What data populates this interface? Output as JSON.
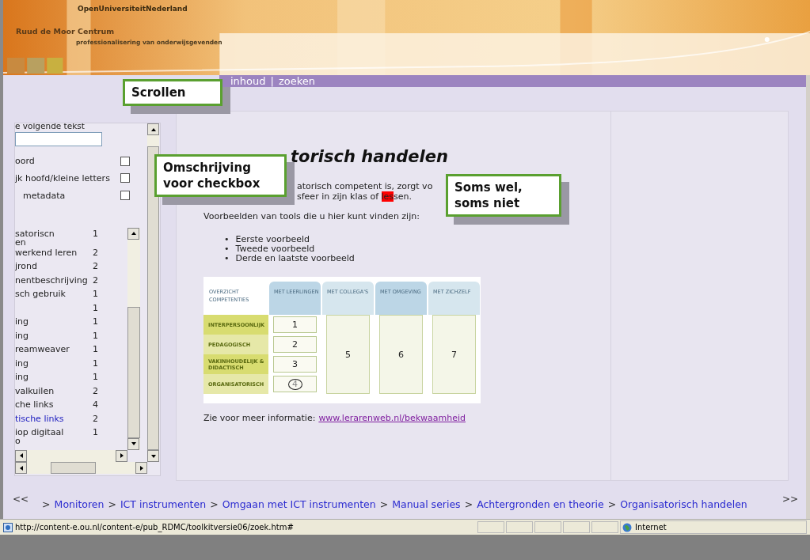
{
  "banner": {
    "org": "OpenUniversiteitNederland",
    "centre": "Ruud de Moor Centrum",
    "tagline": "professionalisering van onderwijsgevenden",
    "kind": "picture"
  },
  "nav": {
    "links": [
      "inhoud",
      "zoeken"
    ],
    "separator": "|"
  },
  "sidebar": {
    "search_label": "e volgende tekst",
    "options": [
      {
        "label": "oord",
        "checked": false
      },
      {
        "label": "jk hoofd/kleine letters",
        "checked": false
      },
      {
        "label": "metadata",
        "checked": false
      }
    ],
    "results": [
      {
        "lines": [
          "satoriscn",
          "en"
        ],
        "count": "1",
        "kind": "plain"
      },
      {
        "lines": [
          "werkend leren"
        ],
        "count": "2",
        "kind": "plain"
      },
      {
        "lines": [
          "jrond"
        ],
        "count": "2",
        "kind": "plain"
      },
      {
        "lines": [
          "nentbeschrijving"
        ],
        "count": "2",
        "kind": "plain"
      },
      {
        "lines": [
          "sch gebruik"
        ],
        "count": "1",
        "kind": "plain"
      },
      {
        "count": "1"
      },
      {
        "lines": [
          "ing"
        ],
        "count": "1",
        "kind": "plain"
      },
      {
        "lines": [
          "ing"
        ],
        "count": "1",
        "kind": "plain"
      },
      {
        "lines": [
          "reamweaver"
        ],
        "count": "1",
        "kind": "plain"
      },
      {
        "lines": [
          "ing"
        ],
        "count": "1",
        "kind": "plain"
      },
      {
        "lines": [
          "ing"
        ],
        "count": "1",
        "kind": "plain"
      },
      {
        "lines": [
          "valkuilen"
        ],
        "count": "2",
        "kind": "plain"
      },
      {
        "lines": [
          "che links"
        ],
        "count": "4",
        "kind": "plain"
      },
      {
        "lines": [
          "tische links"
        ],
        "count": "2",
        "kind": "link"
      },
      {
        "lines": [
          "iop digitaal",
          "o"
        ],
        "count": "1",
        "kind": "plain"
      }
    ]
  },
  "main": {
    "heading": "torisch handelen",
    "paragraph": [
      {
        "text": "atorisch competent is, zorgt vo"
      },
      {
        "text": "sfeer in zijn klas of ",
        "highlight": "les",
        "after": "sen."
      }
    ],
    "intro": "Voorbeelden van tools die u hier kunt vinden zijn:",
    "bullet_marker": "•",
    "bullets": [
      "Eerste voorbeeld",
      "Tweede voorbeeld",
      "Derde en laatste voorbeeld"
    ],
    "competences": {
      "columns": [
        "OVERZICHT COMPETENTIES",
        "MET LEERLINGEN",
        "MET COLLEGA'S",
        "MET OMGEVING",
        "MET ZICHZELF"
      ],
      "rows": [
        {
          "label": "INTERPERSOONLIJK",
          "value": "1",
          "circled": false
        },
        {
          "label": "PEDAGOGISCH",
          "value": "2",
          "circled": false
        },
        {
          "label": "VAKINHOUDELIJK & DIDACTISCH",
          "value": "3",
          "circled": false
        },
        {
          "label": "ORGANISATORISCH",
          "value": "4",
          "circled": true
        }
      ],
      "spanning": [
        "5",
        "6",
        "7"
      ]
    },
    "more_info": "Zie voor meer informatie:",
    "more_link": "www.lerarenweb.nl/bekwaamheid"
  },
  "breadcrumb": {
    "previous": "<<",
    "separator": ">",
    "items": [
      "Monitoren",
      "ICT instrumenten",
      "Omgaan met ICT instrumenten",
      "Manual series",
      "Achtergronden en theorie",
      "Organisatorisch handelen"
    ],
    "next": ">>"
  },
  "status_bar": {
    "url": "http://content-e.ou.nl/content-e/pub_RDMC/toolkitversie06/zoek.htm#",
    "zone": "Internet"
  },
  "callouts": [
    {
      "text": "Scrollen",
      "kind": "scroll"
    },
    {
      "text": "Omschrijving voor checkbox",
      "kind": "checkbox"
    },
    {
      "text": "Soms wel, soms niet",
      "kind": "highlight"
    }
  ]
}
